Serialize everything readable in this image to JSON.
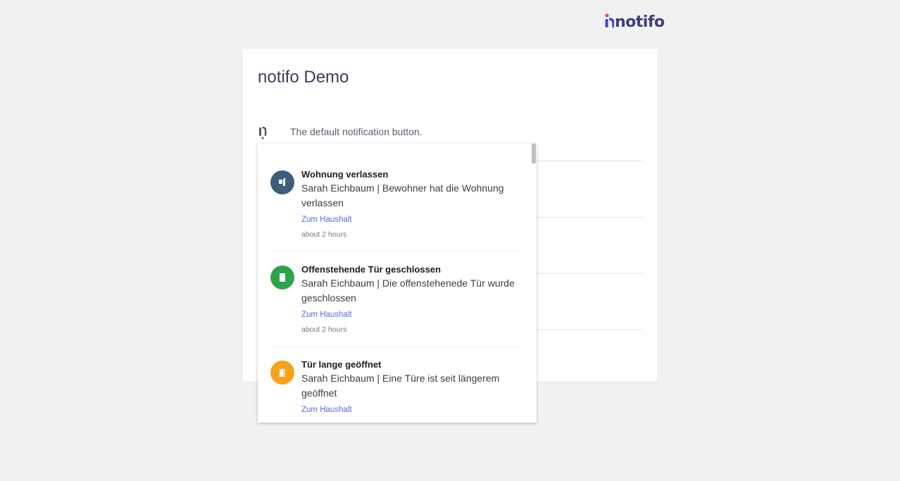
{
  "brand": {
    "logo_text": "notifo",
    "logo_icon": "notifo-logo-icon"
  },
  "page": {
    "title": "notifo Demo"
  },
  "demo_row": {
    "icon": "notification-bell-icon",
    "text": "The default notification button."
  },
  "notifications": [
    {
      "title": "Wohnung verlassen",
      "body": "Sarah Eichbaum | Bewohner hat die Wohnung verlassen",
      "link": "Zum Haushalt",
      "time": "about 2 hours",
      "color": "#3d5d7e",
      "icon": "person-leaving-icon"
    },
    {
      "title": "Offenstehende Tür geschlossen",
      "body": "Sarah Eichbaum | Die offenstehenede Tür wurde geschlossen",
      "link": "Zum Haushalt",
      "time": "about 2 hours",
      "color": "#2ea44a",
      "icon": "door-closed-icon"
    },
    {
      "title": "Tür lange geöffnet",
      "body": "Sarah Eichbaum | Eine Türe ist seit längerem geöffnet",
      "link": "Zum Haushalt",
      "time": "",
      "color": "#f7a21b",
      "icon": "door-open-icon"
    }
  ]
}
